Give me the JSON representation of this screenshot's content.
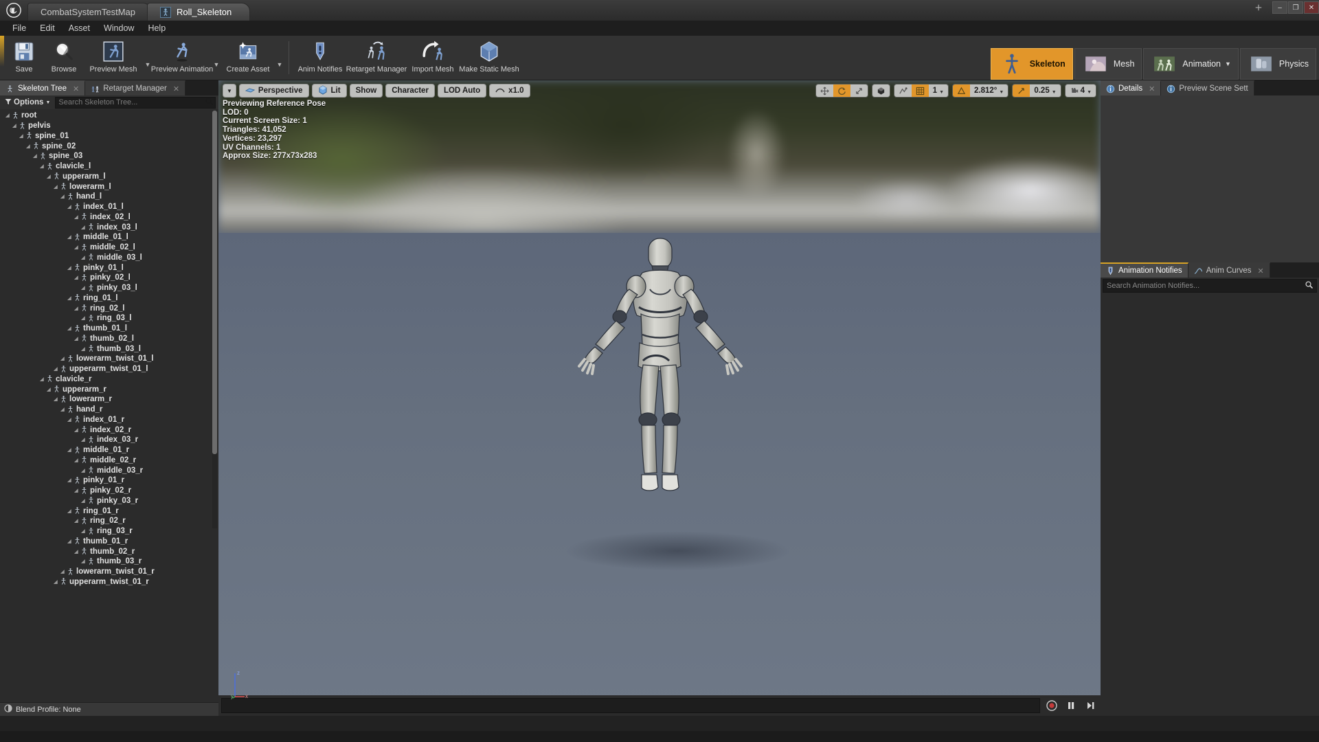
{
  "window": {
    "tabs": [
      {
        "label": "CombatSystemTestMap",
        "active": false,
        "icon": "map-icon"
      },
      {
        "label": "Roll_Skeleton",
        "active": true,
        "icon": "skeleton-icon"
      }
    ],
    "controls": {
      "minimize": "–",
      "maximize": "❐",
      "close": "✕",
      "extra": "❐"
    }
  },
  "menu": {
    "items": [
      "File",
      "Edit",
      "Asset",
      "Window",
      "Help"
    ]
  },
  "toolbar": {
    "items": [
      {
        "label": "Save",
        "icon": "save-icon",
        "caret": false
      },
      {
        "label": "Browse",
        "icon": "browse-icon",
        "caret": false
      },
      {
        "label": "Preview Mesh",
        "icon": "preview-mesh-icon",
        "caret": true
      },
      {
        "label": "Preview Animation",
        "icon": "preview-animation-icon",
        "caret": true
      },
      {
        "label": "Create Asset",
        "icon": "create-asset-icon",
        "caret": true
      }
    ],
    "items2": [
      {
        "label": "Anim Notifies",
        "icon": "anim-notifies-icon",
        "caret": false
      },
      {
        "label": "Retarget Manager",
        "icon": "retarget-manager-icon",
        "caret": false
      },
      {
        "label": "Import Mesh",
        "icon": "import-mesh-icon",
        "caret": false
      },
      {
        "label": "Make Static Mesh",
        "icon": "make-static-mesh-icon",
        "caret": false
      }
    ],
    "modes": [
      {
        "label": "Skeleton",
        "icon": "skeleton-mode-icon",
        "active": true,
        "caret": false
      },
      {
        "label": "Mesh",
        "icon": "mesh-mode-icon",
        "active": false,
        "caret": false
      },
      {
        "label": "Animation",
        "icon": "animation-mode-icon",
        "active": false,
        "caret": true
      },
      {
        "label": "Physics",
        "icon": "physics-mode-icon",
        "active": false,
        "caret": false
      }
    ]
  },
  "left_panel": {
    "tabs": [
      {
        "label": "Skeleton Tree",
        "icon": "skeleton-tree-icon",
        "active": true,
        "closable": true
      },
      {
        "label": "Retarget Manager",
        "icon": "retarget-manager-icon",
        "active": false,
        "closable": true
      }
    ],
    "options_label": "Options",
    "search_placeholder": "Search Skeleton Tree...",
    "search_value": "",
    "blend_profile": "Blend Profile: None",
    "tree": [
      {
        "name": "root",
        "depth": 0
      },
      {
        "name": "pelvis",
        "depth": 1
      },
      {
        "name": "spine_01",
        "depth": 2
      },
      {
        "name": "spine_02",
        "depth": 3
      },
      {
        "name": "spine_03",
        "depth": 4
      },
      {
        "name": "clavicle_l",
        "depth": 5
      },
      {
        "name": "upperarm_l",
        "depth": 6
      },
      {
        "name": "lowerarm_l",
        "depth": 7
      },
      {
        "name": "hand_l",
        "depth": 8
      },
      {
        "name": "index_01_l",
        "depth": 9
      },
      {
        "name": "index_02_l",
        "depth": 10
      },
      {
        "name": "index_03_l",
        "depth": 11
      },
      {
        "name": "middle_01_l",
        "depth": 9
      },
      {
        "name": "middle_02_l",
        "depth": 10
      },
      {
        "name": "middle_03_l",
        "depth": 11
      },
      {
        "name": "pinky_01_l",
        "depth": 9
      },
      {
        "name": "pinky_02_l",
        "depth": 10
      },
      {
        "name": "pinky_03_l",
        "depth": 11
      },
      {
        "name": "ring_01_l",
        "depth": 9
      },
      {
        "name": "ring_02_l",
        "depth": 10
      },
      {
        "name": "ring_03_l",
        "depth": 11
      },
      {
        "name": "thumb_01_l",
        "depth": 9
      },
      {
        "name": "thumb_02_l",
        "depth": 10
      },
      {
        "name": "thumb_03_l",
        "depth": 11
      },
      {
        "name": "lowerarm_twist_01_l",
        "depth": 8
      },
      {
        "name": "upperarm_twist_01_l",
        "depth": 7
      },
      {
        "name": "clavicle_r",
        "depth": 5
      },
      {
        "name": "upperarm_r",
        "depth": 6
      },
      {
        "name": "lowerarm_r",
        "depth": 7
      },
      {
        "name": "hand_r",
        "depth": 8
      },
      {
        "name": "index_01_r",
        "depth": 9
      },
      {
        "name": "index_02_r",
        "depth": 10
      },
      {
        "name": "index_03_r",
        "depth": 11
      },
      {
        "name": "middle_01_r",
        "depth": 9
      },
      {
        "name": "middle_02_r",
        "depth": 10
      },
      {
        "name": "middle_03_r",
        "depth": 11
      },
      {
        "name": "pinky_01_r",
        "depth": 9
      },
      {
        "name": "pinky_02_r",
        "depth": 10
      },
      {
        "name": "pinky_03_r",
        "depth": 11
      },
      {
        "name": "ring_01_r",
        "depth": 9
      },
      {
        "name": "ring_02_r",
        "depth": 10
      },
      {
        "name": "ring_03_r",
        "depth": 11
      },
      {
        "name": "thumb_01_r",
        "depth": 9
      },
      {
        "name": "thumb_02_r",
        "depth": 10
      },
      {
        "name": "thumb_03_r",
        "depth": 11
      },
      {
        "name": "lowerarm_twist_01_r",
        "depth": 8
      },
      {
        "name": "upperarm_twist_01_r",
        "depth": 7
      }
    ]
  },
  "viewport": {
    "buttons": [
      {
        "label": "",
        "icon": "chevron-down-icon",
        "name": "viewport-options-menu"
      },
      {
        "label": "Perspective",
        "icon": "perspective-icon",
        "name": "camera-mode-button"
      },
      {
        "label": "Lit",
        "icon": "lit-cube-icon",
        "name": "view-mode-button"
      },
      {
        "label": "Show",
        "icon": "",
        "name": "show-flags-button"
      },
      {
        "label": "Character",
        "icon": "",
        "name": "character-button"
      },
      {
        "label": "LOD Auto",
        "icon": "",
        "name": "lod-button"
      },
      {
        "label": "x1.0",
        "icon": "playrate-icon",
        "name": "playback-speed-button"
      }
    ],
    "transform_tools": [
      {
        "icon": "translate-icon",
        "active": false
      },
      {
        "icon": "rotate-icon",
        "active": true
      },
      {
        "icon": "scale-icon",
        "active": false
      }
    ],
    "coord_icon": "world-coords-icon",
    "snap_controls": [
      {
        "icon": "surface-snap-icon",
        "value": "",
        "active": false
      },
      {
        "icon": "grid-snap-icon",
        "value": "",
        "active": true
      },
      {
        "icon": "",
        "value": "1",
        "active": false
      },
      {
        "icon": "angle-snap-icon",
        "value": "",
        "active": true
      },
      {
        "icon": "",
        "value": "2.812°",
        "active": false
      },
      {
        "icon": "scale-snap-icon",
        "value": "",
        "active": true
      },
      {
        "icon": "",
        "value": "0.25",
        "active": false
      },
      {
        "icon": "camera-speed-icon",
        "value": "4",
        "active": false
      }
    ],
    "stats": [
      "Previewing Reference Pose",
      "LOD: 0",
      "Current Screen Size: 1",
      "Triangles: 41,052",
      "Vertices: 23,297",
      "UV Channels: 1",
      "Approx Size: 277x73x283"
    ],
    "axis_labels": {
      "z": "z",
      "y": "y",
      "x": "x"
    },
    "timeline": {
      "value": "",
      "record_icon": "record-icon",
      "pause_icon": "pause-icon",
      "step_icon": "step-forward-icon"
    }
  },
  "right_panel": {
    "top_tabs": [
      {
        "label": "Details",
        "icon": "details-icon",
        "active": true,
        "closable": true
      },
      {
        "label": "Preview Scene Sett",
        "icon": "preview-scene-icon",
        "active": false,
        "closable": false
      }
    ],
    "bottom_tabs": [
      {
        "label": "Animation Notifies",
        "icon": "anim-notifies-icon",
        "active": true,
        "closable": false
      },
      {
        "label": "Anim Curves",
        "icon": "anim-curves-icon",
        "active": false,
        "closable": true
      }
    ],
    "search_placeholder": "Search Animation Notifies...",
    "search_value": ""
  },
  "colors": {
    "accent_orange": "#e2962a",
    "panel_bg": "#2b2b2b",
    "toolbar_bg": "#333333",
    "viewport_floor": "#66707f"
  }
}
